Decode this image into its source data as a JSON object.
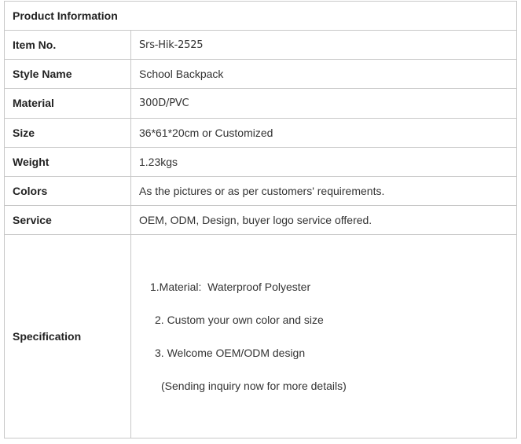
{
  "header": {
    "title": "Product Information"
  },
  "rows": [
    {
      "label": "Item No.",
      "value": "Srs-Hik-2525"
    },
    {
      "label": "Style  Name",
      "value": "School Backpack"
    },
    {
      "label": "Material",
      "value": "300D/PVC"
    },
    {
      "label": "Size",
      "value": "36*61*20cm or Customized"
    },
    {
      "label": "Weight",
      "value": "1.23kgs"
    },
    {
      "label": "Colors",
      "value": "As the pictures or as  per customers' requirements."
    },
    {
      "label": "Service",
      "value": "OEM, ODM, Design, buyer logo service offered."
    }
  ],
  "specification": {
    "label": "Specification",
    "lines": [
      "1.Material:  Waterproof Polyester",
      "2. Custom your own color and size",
      "3. Welcome OEM/ODM design",
      "(Sending inquiry now for more details)"
    ]
  }
}
